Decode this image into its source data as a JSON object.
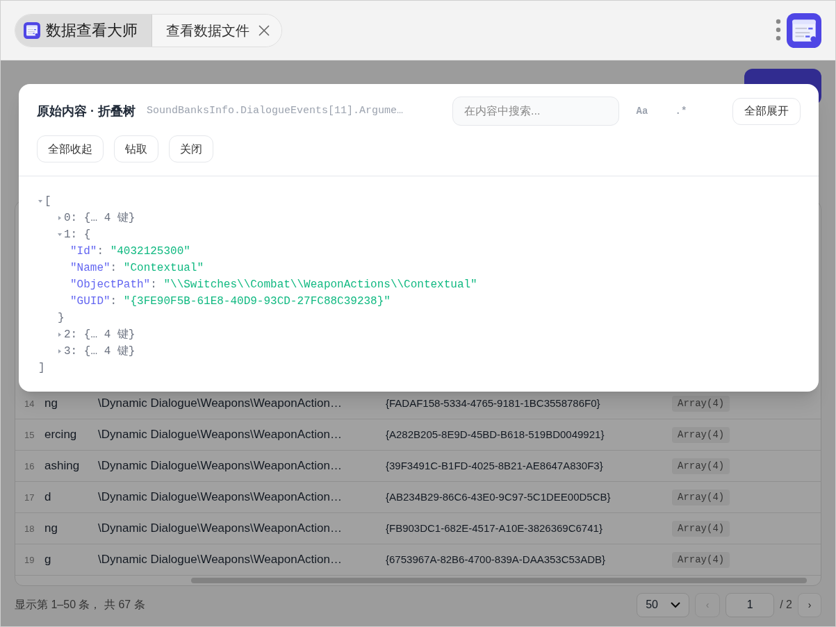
{
  "top_bar": {
    "app_name": "数据查看大师",
    "tabs": [
      {
        "label": "查看数据文件",
        "selected": true
      }
    ]
  },
  "modal": {
    "title": "原始内容 · 折叠树",
    "path": "SoundBanksInfo.DialogueEvents[11].Argume…",
    "search": {
      "placeholder": "在内容中搜索..."
    },
    "toggles": [
      {
        "label": "Aa",
        "selected": false
      },
      {
        "label": ".*",
        "selected": false
      }
    ],
    "buttons": [
      "全部展开",
      "全部收起",
      "钻取",
      "关闭"
    ],
    "tree": {
      "separator": ":",
      "open": "[",
      "close": "]",
      "expanded": true,
      "children": [
        {
          "key": "0",
          "expanded": false,
          "summary": "{… 4 键}"
        },
        {
          "key": "1",
          "expanded": true,
          "open": "{",
          "close": "}",
          "fields": [
            {
              "key": "\"Id\"",
              "value": "\"4032125300\""
            },
            {
              "key": "\"Name\"",
              "value": "\"Contextual\""
            },
            {
              "key": "\"ObjectPath\"",
              "value": "\"\\\\Switches\\\\Combat\\\\WeaponActions\\\\Contextual\""
            },
            {
              "key": "\"GUID\"",
              "value": "\"{3FE90F5B-61E8-40D9-93CD-27FC88C39238}\""
            }
          ]
        },
        {
          "key": "2",
          "expanded": false,
          "summary": "{… 4 键}"
        },
        {
          "key": "3",
          "expanded": false,
          "summary": "{… 4 键}"
        }
      ]
    }
  },
  "table": {
    "rows": [
      {
        "number": "14",
        "name": "ng",
        "path": "\\Dynamic Dialogue\\Weapons\\WeaponAction…",
        "guid": "{FADAF158-5334-4765-9181-1BC3558786F0}",
        "arguments": "Array(4)"
      },
      {
        "number": "15",
        "name": "ercing",
        "path": "\\Dynamic Dialogue\\Weapons\\WeaponAction…",
        "guid": "{A282B205-8E9D-45BD-B618-519BD0049921}",
        "arguments": "Array(4)"
      },
      {
        "number": "16",
        "name": "ashing",
        "path": "\\Dynamic Dialogue\\Weapons\\WeaponAction…",
        "guid": "{39F3491C-B1FD-4025-8B21-AE8647A830F3}",
        "arguments": "Array(4)"
      },
      {
        "number": "17",
        "name": "d",
        "path": "\\Dynamic Dialogue\\Weapons\\WeaponAction…",
        "guid": "{AB234B29-86C6-43E0-9C97-5C1DEE00D5CB}",
        "arguments": "Array(4)"
      },
      {
        "number": "18",
        "name": "ng",
        "path": "\\Dynamic Dialogue\\Weapons\\WeaponAction…",
        "guid": "{FB903DC1-682E-4517-A10E-3826369C6741}",
        "arguments": "Array(4)"
      },
      {
        "number": "19",
        "name": "g",
        "path": "\\Dynamic Dialogue\\Weapons\\WeaponAction…",
        "guid": "{6753967A-82B6-4700-839A-DAA353C53ADB}",
        "arguments": "Array(4)"
      }
    ]
  },
  "footer": {
    "summary": "显示第 1–50 条， 共 67 条",
    "page_size": "50",
    "page": "1",
    "total_pages": "/ 2",
    "prev_disabled": true,
    "next_disabled": false,
    "prev": "‹",
    "next": "›"
  }
}
